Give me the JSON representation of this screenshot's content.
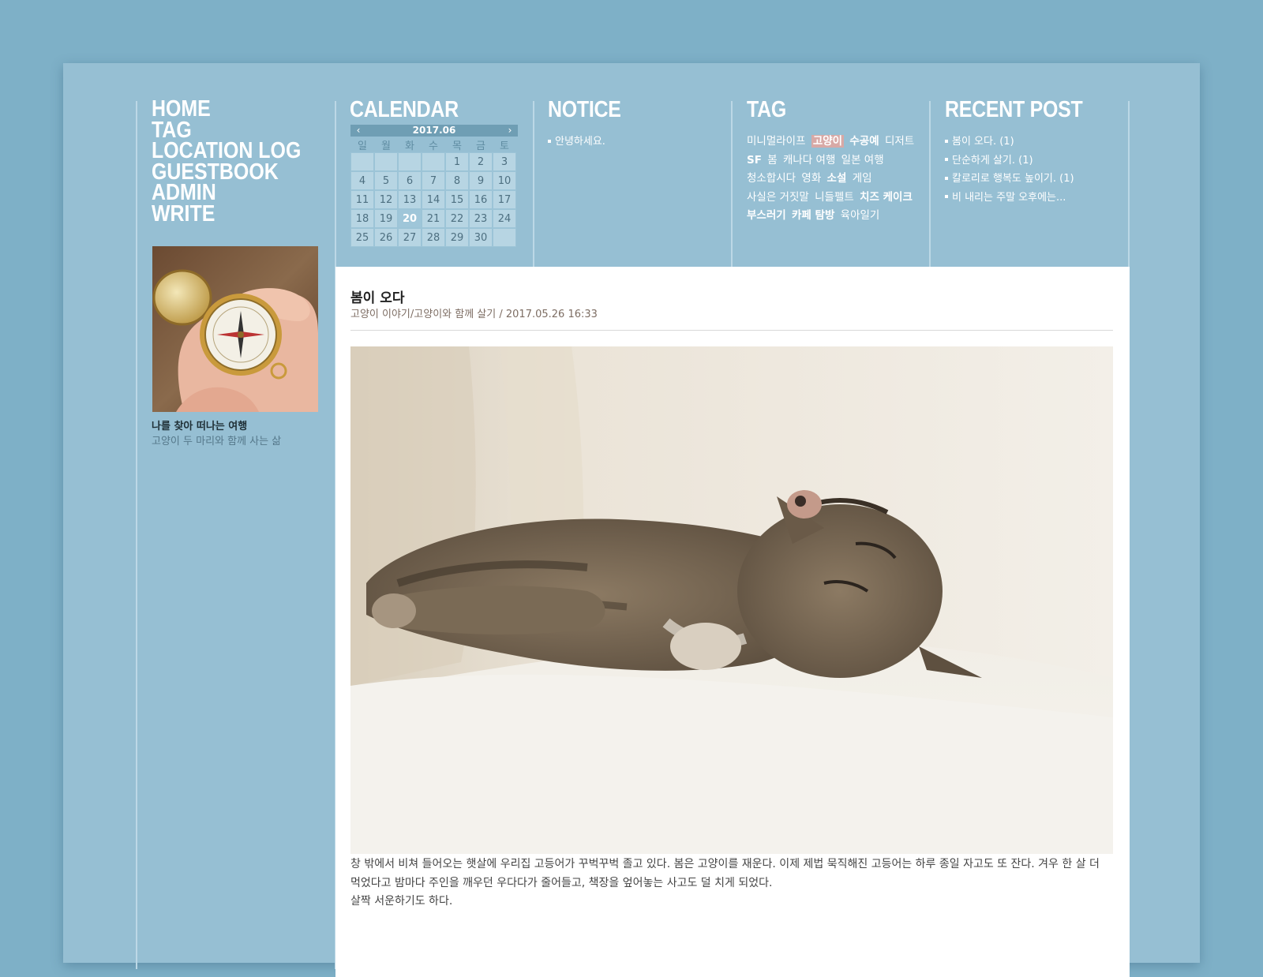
{
  "nav": [
    "HOME",
    "TAG",
    "LOCATION LOG",
    "GUESTBOOK",
    "ADMIN",
    "WRITE"
  ],
  "profile": {
    "name": "나를 찾아 떠나는 여행",
    "description": "고양이 두 마리와 함께 사는 삶"
  },
  "headers": {
    "calendar": "CALENDAR",
    "notice": "NOTICE",
    "tag": "TAG",
    "recent": "RECENT POST"
  },
  "calendar": {
    "month": "2017.06",
    "prev": "‹",
    "next": "›",
    "weekdays": [
      "일",
      "월",
      "화",
      "수",
      "목",
      "금",
      "토"
    ],
    "weeks": [
      [
        "",
        "",
        "",
        "",
        "1",
        "2",
        "3"
      ],
      [
        "4",
        "5",
        "6",
        "7",
        "8",
        "9",
        "10"
      ],
      [
        "11",
        "12",
        "13",
        "14",
        "15",
        "16",
        "17"
      ],
      [
        "18",
        "19",
        "20",
        "21",
        "22",
        "23",
        "24"
      ],
      [
        "25",
        "26",
        "27",
        "28",
        "29",
        "30",
        ""
      ]
    ],
    "today": "20"
  },
  "notice": [
    "안녕하세요."
  ],
  "tags": [
    {
      "label": "미니멀라이프",
      "style": "normal"
    },
    {
      "label": "고양이",
      "style": "highlight"
    },
    {
      "label": "수공예",
      "style": "bold"
    },
    {
      "label": "디저트",
      "style": "normal"
    },
    {
      "label": "SF",
      "style": "bold"
    },
    {
      "label": "봄",
      "style": "normal"
    },
    {
      "label": "캐나다 여행",
      "style": "normal"
    },
    {
      "label": "일본 여행",
      "style": "normal"
    },
    {
      "label": "청소합시다",
      "style": "normal"
    },
    {
      "label": "영화",
      "style": "normal"
    },
    {
      "label": "소설",
      "style": "bold"
    },
    {
      "label": "게임",
      "style": "normal"
    },
    {
      "label": "사실은 거짓말",
      "style": "normal"
    },
    {
      "label": "니들펠트",
      "style": "normal"
    },
    {
      "label": "치즈 케이크",
      "style": "bold"
    },
    {
      "label": "부스러기",
      "style": "bold"
    },
    {
      "label": "카페 탐방",
      "style": "bold"
    },
    {
      "label": "육아일기",
      "style": "normal"
    }
  ],
  "recent": [
    "봄이 오다. (1)",
    "단순하게 살기. (1)",
    "칼로리로 행복도 높이기. (1)",
    "비 내리는 주말 오후에는..."
  ],
  "post": {
    "title": "봄이 오다",
    "category": "고양이 이야기/고양이와 함께 살기",
    "separator": " / ",
    "date": "2017.05.26 16:33",
    "body": [
      "창 밖에서 비쳐 들어오는 햇살에 우리집 고등어가 꾸벅꾸벅 졸고 있다. 봄은 고양이를 재운다. 이제 제법 묵직해진 고등어는 하루 종일 자고도 또 잔다. 겨우 한 살 더 먹었다고 밤마다 주인을 깨우던 우다다가 줄어들고, 책장을 엎어놓는 사고도 덜 치게 되었다.",
      "살짝 서운하기도 하다."
    ]
  }
}
